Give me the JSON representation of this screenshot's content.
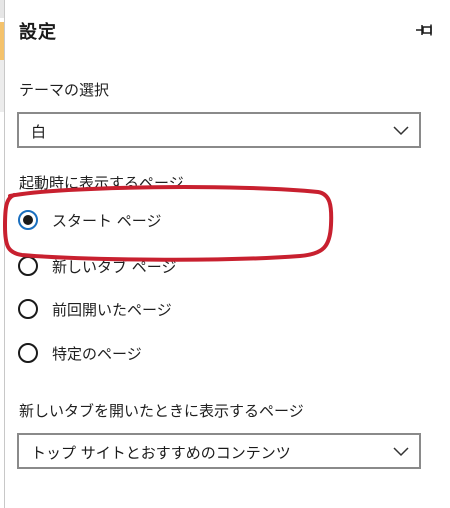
{
  "panel": {
    "title": "設定"
  },
  "theme": {
    "label": "テーマの選択",
    "value": "白"
  },
  "startup": {
    "label": "起動時に表示するページ",
    "options": [
      {
        "label": "スタート ページ",
        "selected": true
      },
      {
        "label": "新しいタブ ページ",
        "selected": false
      },
      {
        "label": "前回開いたページ",
        "selected": false
      },
      {
        "label": "特定のページ",
        "selected": false
      }
    ]
  },
  "newtab": {
    "label": "新しいタブを開いたときに表示するページ",
    "value": "トップ サイトとおすすめのコンテンツ"
  },
  "icons": {
    "pin": "pin-icon",
    "dropdown": "chevron-down-icon"
  },
  "colors": {
    "highlight": "#c8202f",
    "radio_selected_ring": "#1a6fbf"
  }
}
